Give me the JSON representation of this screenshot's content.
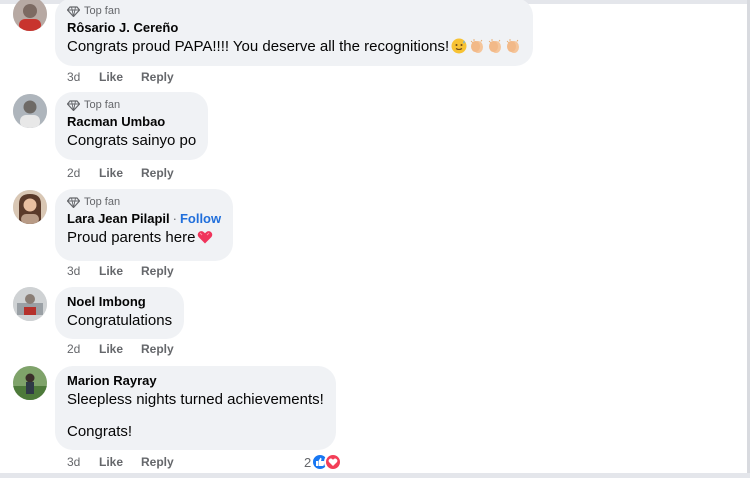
{
  "comments": [
    {
      "badge": "Top fan",
      "name": "Rôsario J. Cereño",
      "text": "Congrats proud PAPA!!!! You deserve all the recognitions!",
      "emoji": [
        "sweat-smile",
        "clap",
        "clap",
        "clap"
      ],
      "time": "3d",
      "like": "Like",
      "reply": "Reply"
    },
    {
      "badge": "Top fan",
      "name": "Racman Umbao",
      "text": "Congrats sainyo po",
      "time": "2d",
      "like": "Like",
      "reply": "Reply"
    },
    {
      "badge": "Top fan",
      "name": "Lara Jean Pilapil",
      "follow": "Follow",
      "separator": "·",
      "text": "Proud parents here",
      "emoji": [
        "heart"
      ],
      "time": "3d",
      "like": "Like",
      "reply": "Reply"
    },
    {
      "name": "Noel Imbong",
      "text": "Congratulations",
      "time": "2d",
      "like": "Like",
      "reply": "Reply"
    },
    {
      "name": "Marion Rayray",
      "text": "Sleepless nights turned achievements!",
      "text2": "Congrats!",
      "time": "3d",
      "like": "Like",
      "reply": "Reply",
      "reaction_count": "2",
      "reactions": [
        "like-icon",
        "love-icon"
      ]
    }
  ],
  "colors": {
    "bubble": "#f0f2f5",
    "link": "#216fdb",
    "meta": "#65676b",
    "like": "#1877f2",
    "love": "#f33e58"
  }
}
